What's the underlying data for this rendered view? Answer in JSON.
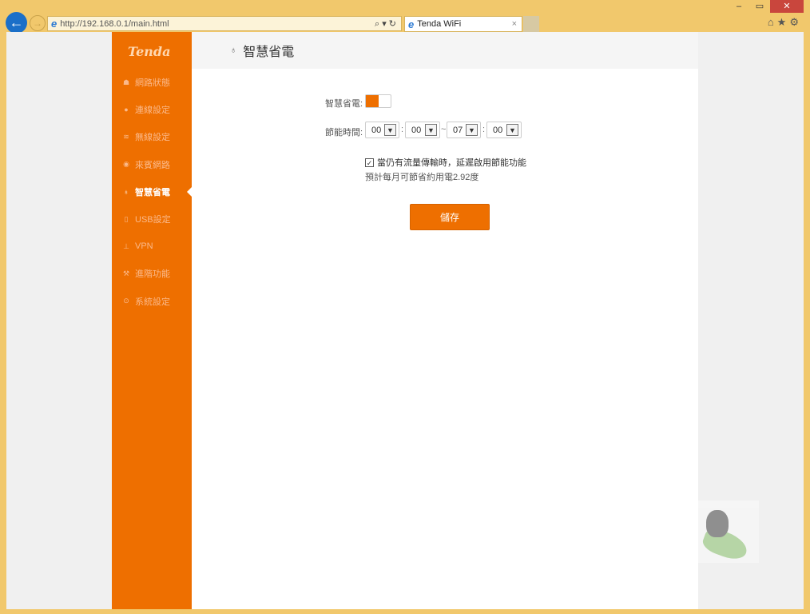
{
  "browser": {
    "url": "http://192.168.0.1/main.html",
    "tab_title": "Tenda WiFi",
    "addr_tools": "⌕ ▾ ↻",
    "tab_close": "×",
    "right_icons": "⌂★⚙",
    "win_controls": [
      "–",
      "▭",
      "✕"
    ]
  },
  "sidebar": {
    "logo": "Tenda",
    "items": [
      {
        "label": "網路狀態",
        "icon": "status-icon",
        "glyph": "☗"
      },
      {
        "label": "連線設定",
        "icon": "globe-icon",
        "glyph": "●"
      },
      {
        "label": "無線設定",
        "icon": "wifi-icon",
        "glyph": "≋"
      },
      {
        "label": "來賓網路",
        "icon": "guest-icon",
        "glyph": "◉"
      },
      {
        "label": "智慧省電",
        "icon": "bulb-icon",
        "glyph": "♁",
        "active": true
      },
      {
        "label": "USB設定",
        "icon": "usb-icon",
        "glyph": "▯"
      },
      {
        "label": "VPN",
        "icon": "vpn-icon",
        "glyph": "⊥"
      },
      {
        "label": "進階功能",
        "icon": "wrench-icon",
        "glyph": "⚒"
      },
      {
        "label": "系統設定",
        "icon": "gear-icon",
        "glyph": "⊙"
      }
    ]
  },
  "page": {
    "title": "智慧省電",
    "title_icon": "bulb-icon",
    "power_saving_label": "智慧省電:",
    "power_saving_on": true,
    "time_label": "節能時間:",
    "start_hour": "00",
    "start_min": "00",
    "end_hour": "07",
    "end_min": "00",
    "colon": ":",
    "tilde": "~",
    "delay_checked": true,
    "delay_label": "當仍有流量傳輸時，延遲啟用節能功能",
    "estimate": "預計每月可節省約用電2.92度",
    "save": "儲存"
  },
  "colors": {
    "accent": "#ee6f00",
    "frame": "#f1c86c"
  }
}
